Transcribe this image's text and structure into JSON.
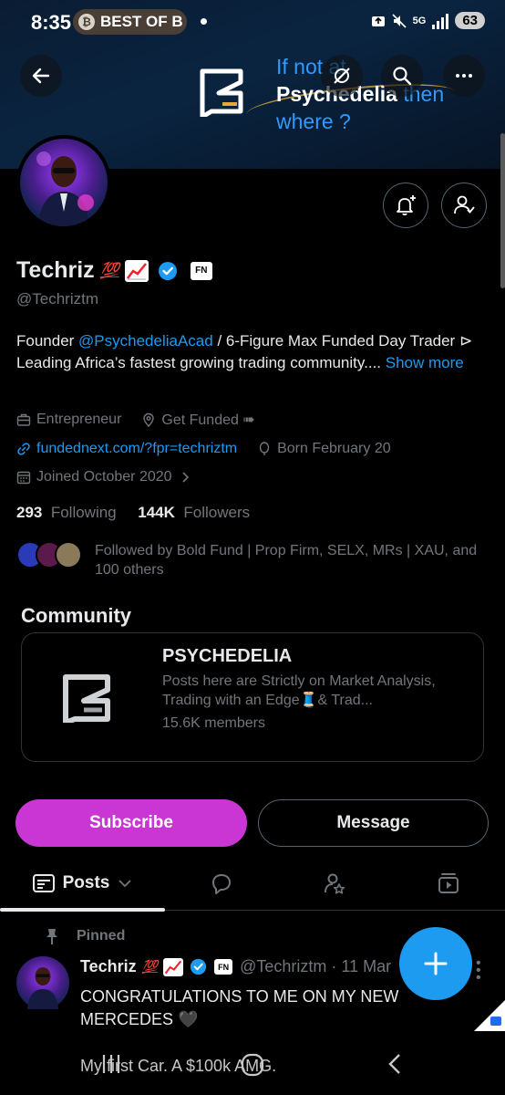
{
  "status_bar": {
    "time": "8:35",
    "notification_chip": "BEST OF B",
    "network": "5G",
    "battery": "63"
  },
  "banner": {
    "line1": "If not at",
    "line2": "Psychedelia",
    "line2_suffix": "then",
    "line3": "where ?",
    "accent_color": "#2f9bff"
  },
  "profile": {
    "display_name": "Techriz",
    "name_emoji": "💯",
    "fn_badge": "FN",
    "handle": "@Techriztm",
    "bio_prefix": "Founder ",
    "bio_mention": "@PsychedeliaAcad",
    "bio_body": " / 6-Figure Max Funded Day Trader ⊳ Leading Africa’s fastest growing trading community.... ",
    "bio_more": "Show more",
    "category": "Entrepreneur",
    "location": "Get Funded ➠",
    "website": "fundednext.com/?fpr=techriztm",
    "birthday": "Born February 20",
    "joined": "Joined October 2020",
    "following_count": "293",
    "following_label": "Following",
    "followers_count": "144K",
    "followers_label": "Followers",
    "followed_by": "Followed by Bold Fund | Prop Firm, SELX, MRs | XAU, and 100 others"
  },
  "community": {
    "section_title": "Community",
    "name": "PSYCHEDELIA",
    "description": "Posts here are Strictly on Market Analysis, Trading with an Edge🧵& Trad...",
    "members": "15.6K members"
  },
  "actions": {
    "subscribe_label": "Subscribe",
    "message_label": "Message",
    "subscribe_color": "#c936d4"
  },
  "tabs": {
    "posts_label": "Posts"
  },
  "post": {
    "pinned_label": "Pinned",
    "author_name": "Techriz",
    "author_emoji": "💯",
    "fn_badge": "FN",
    "author_handle_time": "@Techriztm · 11 Mar",
    "text": "CONGRATULATIONS TO ME ON MY NEW MERCEDES 🖤",
    "text2": "My first Car. A $100k AMG."
  },
  "icons": {
    "back": "back-arrow-icon",
    "grok": "grok-icon",
    "search": "search-icon",
    "more": "more-icon",
    "notify": "bell-plus-icon",
    "following": "person-check-icon",
    "compose": "plus-icon"
  }
}
